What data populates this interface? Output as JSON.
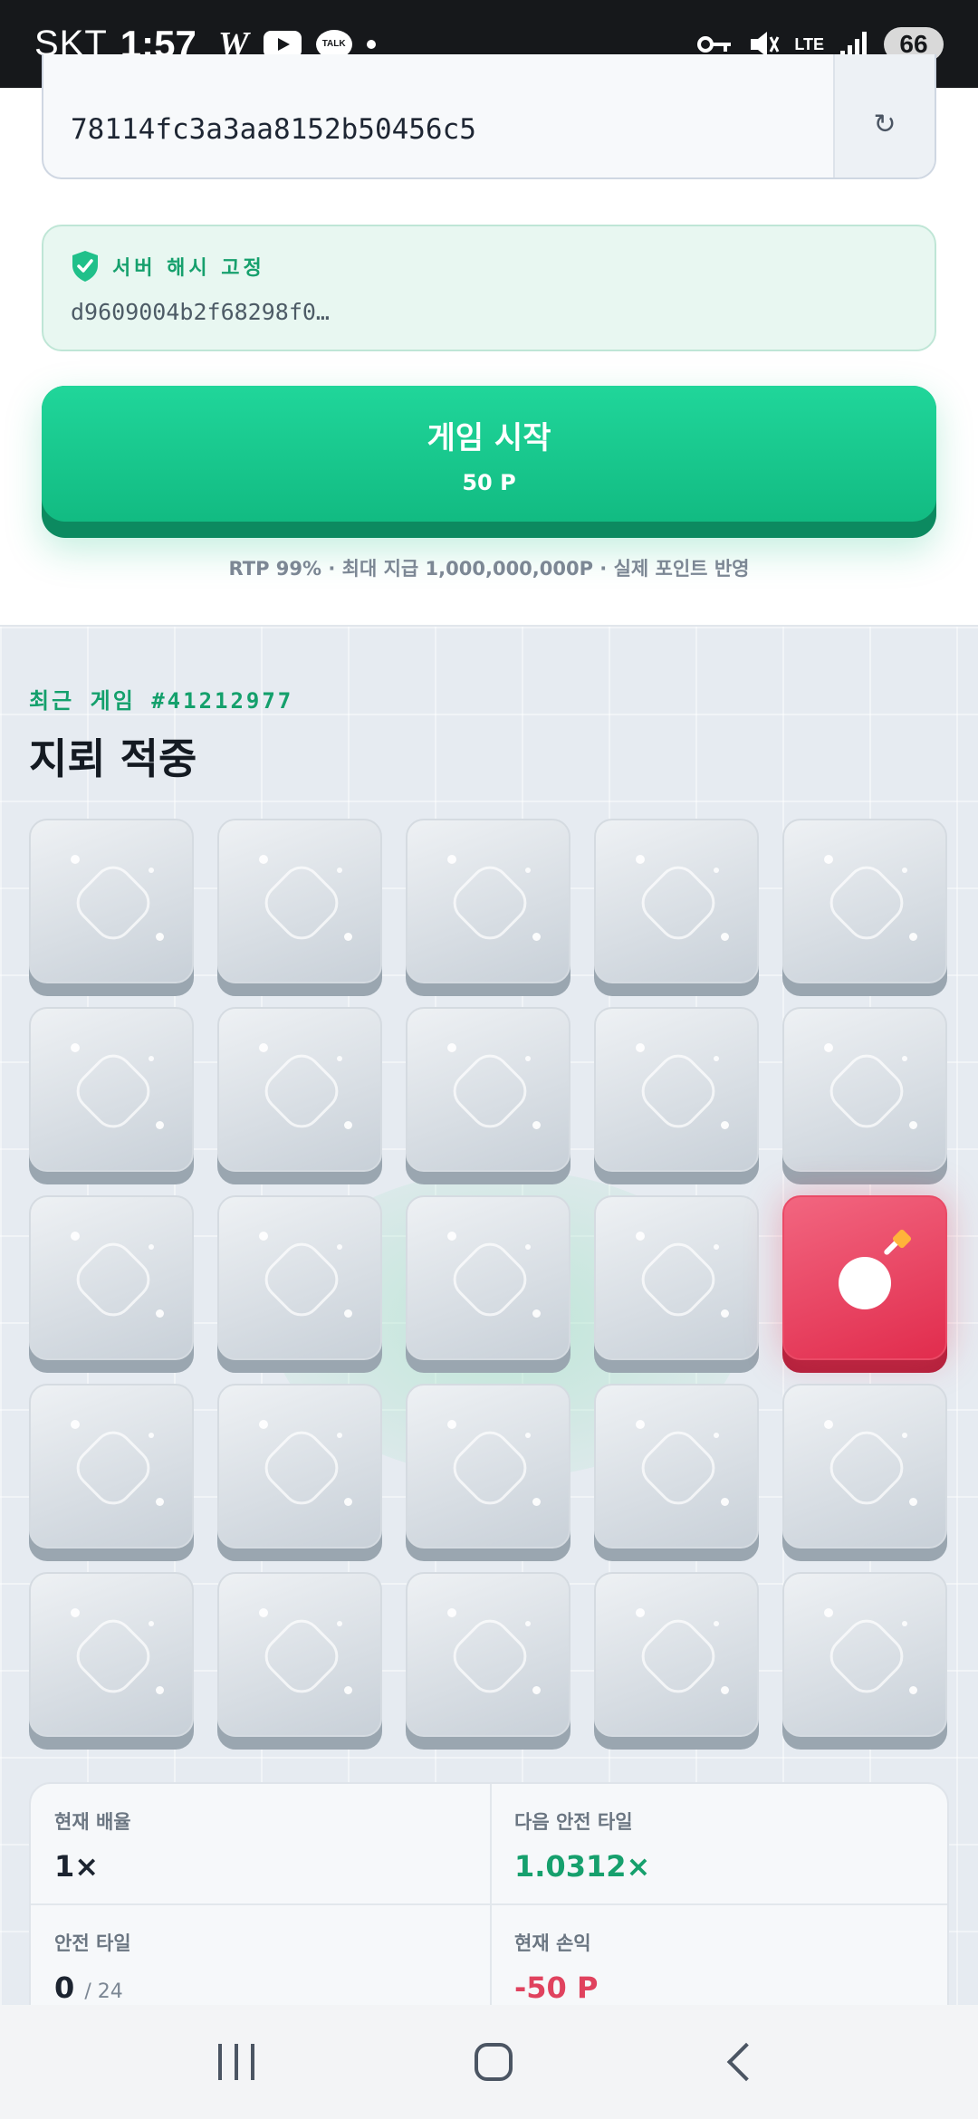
{
  "status_bar": {
    "carrier": "SKT",
    "time": "1:57",
    "w_label": "W",
    "talk_label": "TALK",
    "lte_label": "LTE",
    "battery": "66"
  },
  "seed": {
    "value": "78114fc3a3aa8152b50456c5",
    "refresh_symbol": "↻"
  },
  "server_hash": {
    "title": "서버 해시 고정",
    "value": "d9609004b2f68298f0…"
  },
  "start_button": {
    "label": "게임 시작",
    "cost": "50 P"
  },
  "info": "RTP 99% · 최대 지급 1,000,000,000P · 실제 포인트 반영",
  "recent_game": {
    "label": "최근 게임 #41212977",
    "result": "지뢰 적중"
  },
  "grid": {
    "rows": 5,
    "cols": 5,
    "mine_position": {
      "row": 3,
      "col": 5
    }
  },
  "stats": {
    "current_multiplier_label": "현재 배율",
    "current_multiplier": "1×",
    "next_safe_label": "다음 안전 타일",
    "next_safe": "1.0312×",
    "safe_tiles_label": "안전 타일",
    "safe_tiles_count": "0",
    "safe_tiles_total": "/ 24",
    "pnl_label": "현재 손익",
    "pnl": "-50 P"
  },
  "colors": {
    "accent": "#16a06d",
    "button": "#20d69a",
    "mine": "#e12c4d",
    "loss": "#e0425e"
  }
}
